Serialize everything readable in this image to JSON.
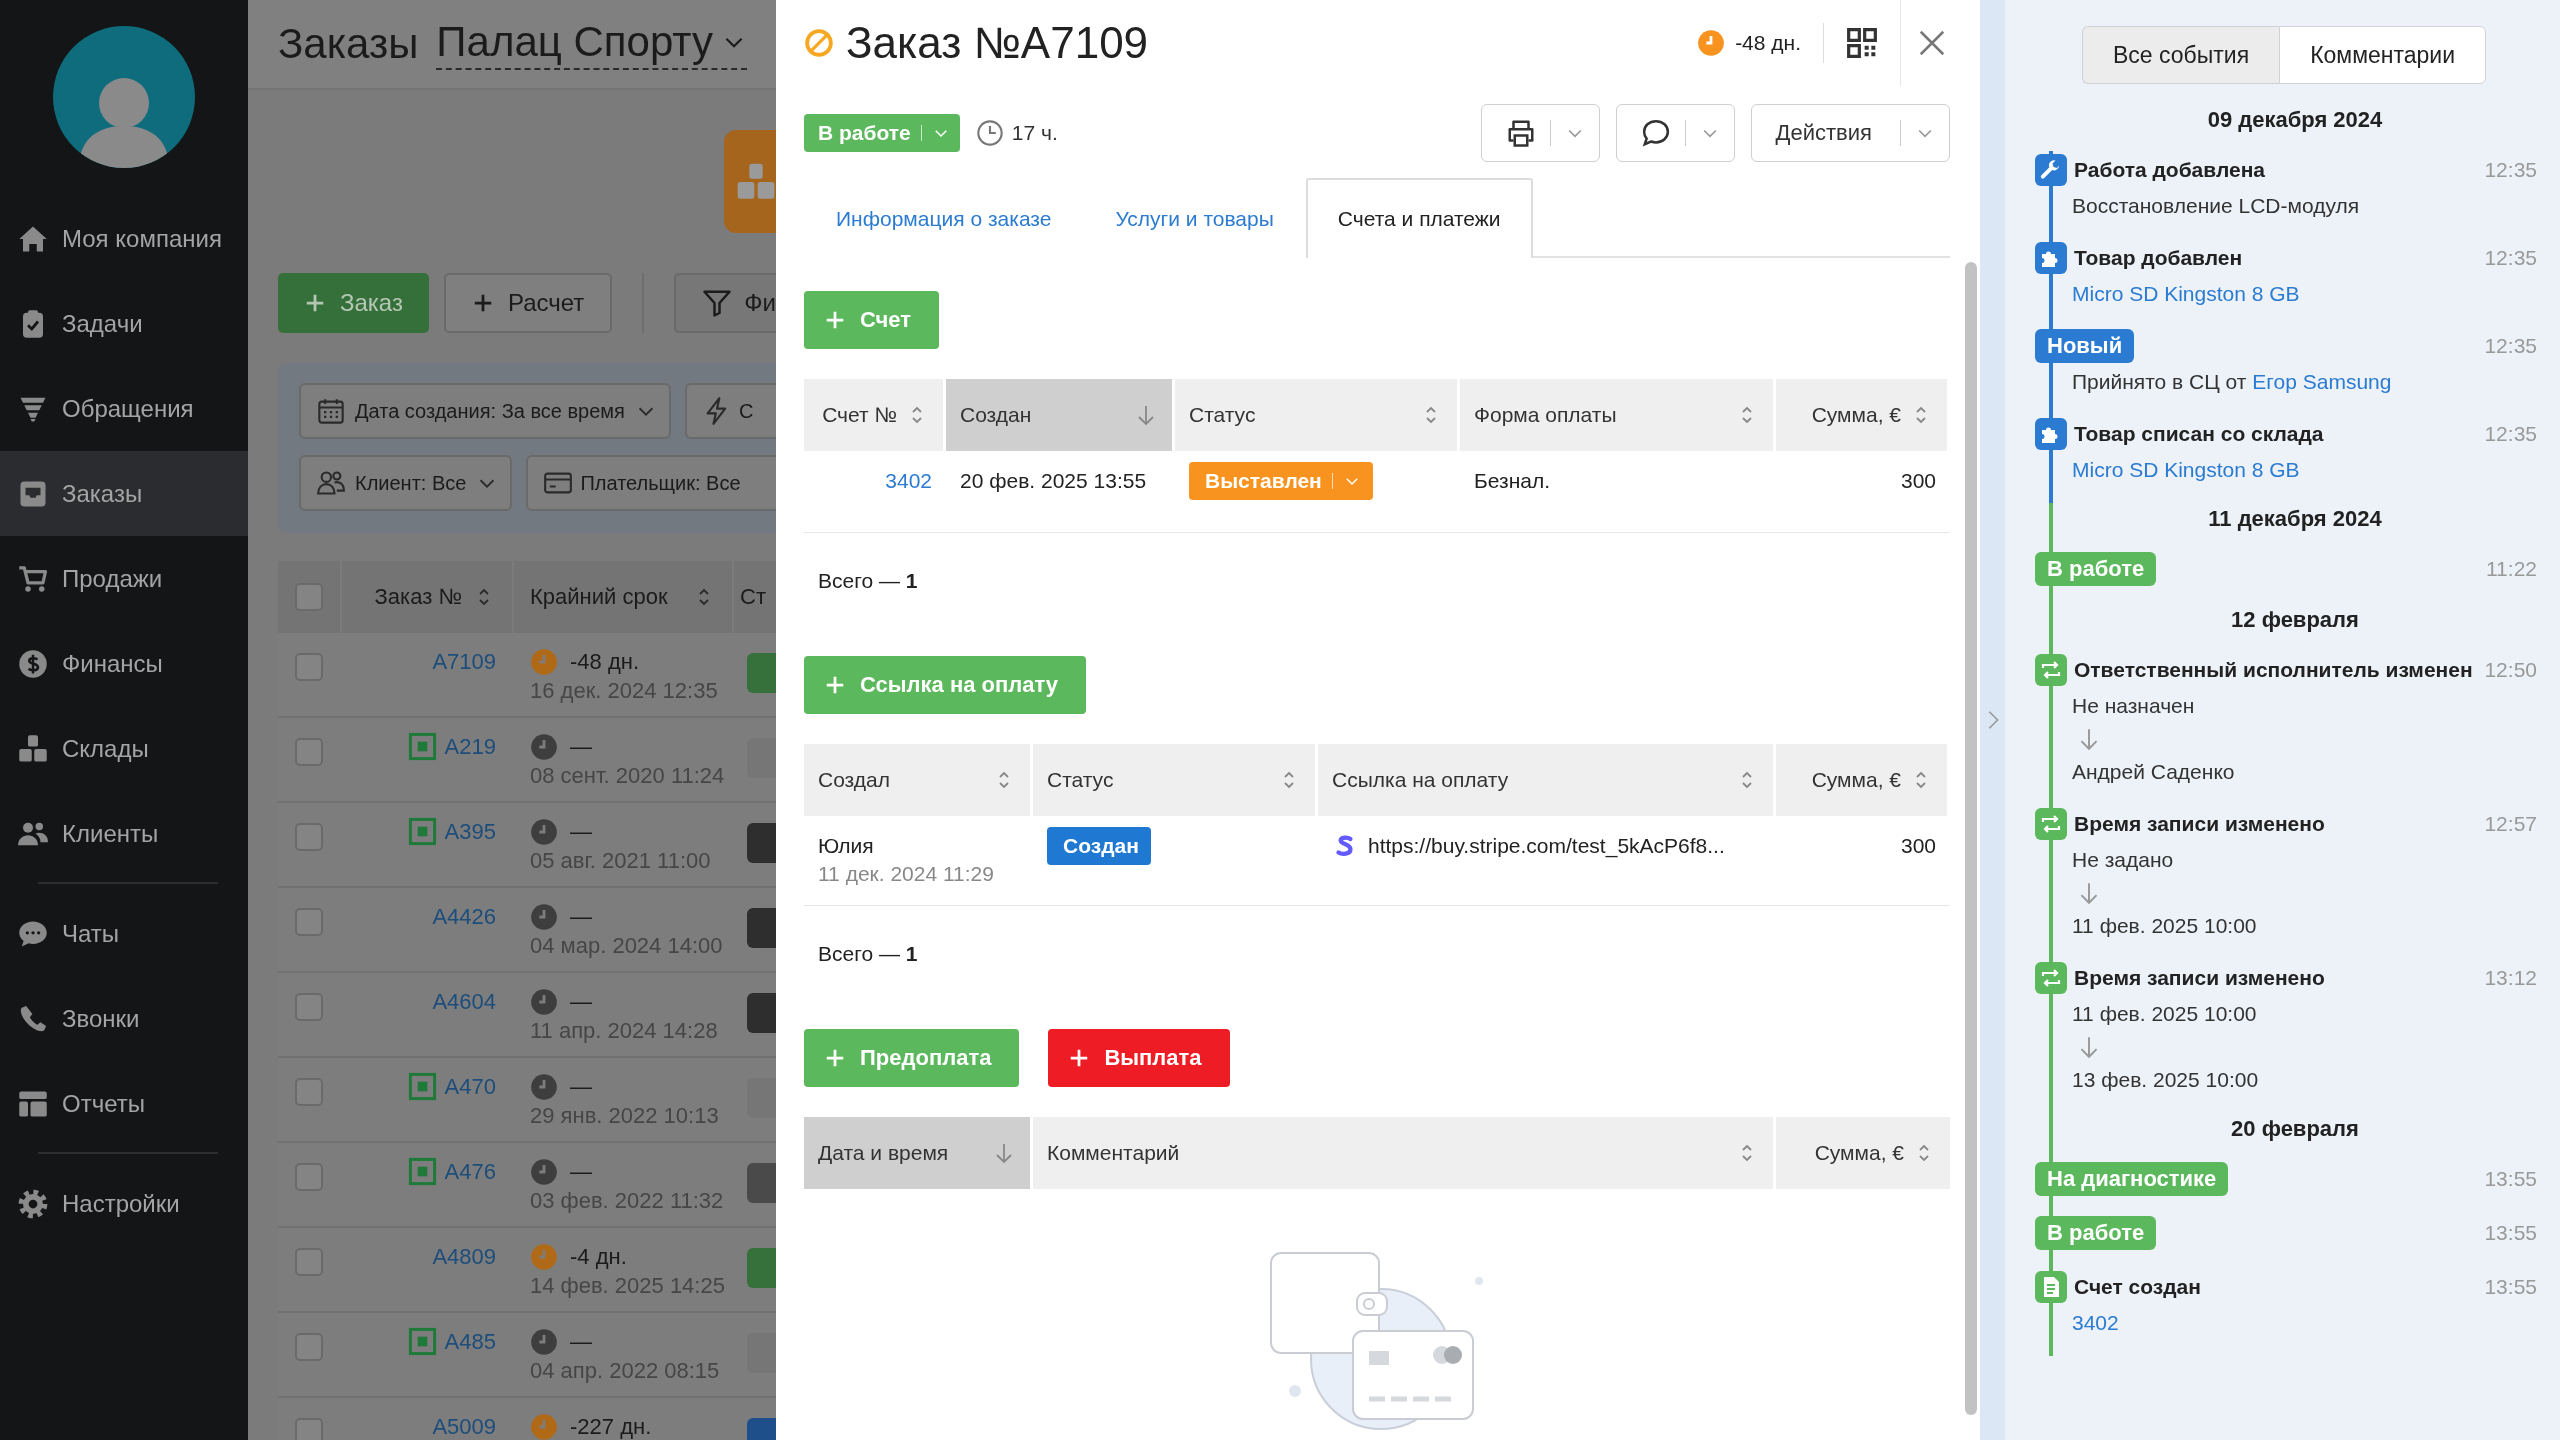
{
  "sidebar": {
    "sections": [
      {
        "items": [
          {
            "label": "Моя компания",
            "selected": false
          },
          {
            "label": "Задачи",
            "selected": false
          },
          {
            "label": "Обращения",
            "selected": false
          },
          {
            "label": "Заказы",
            "selected": true
          },
          {
            "label": "Продажи",
            "selected": false
          },
          {
            "label": "Финансы",
            "selected": false
          },
          {
            "label": "Склады",
            "selected": false
          },
          {
            "label": "Клиенты",
            "selected": false
          }
        ]
      },
      {
        "items": [
          {
            "label": "Чаты",
            "selected": false
          },
          {
            "label": "Звонки",
            "selected": false
          },
          {
            "label": "Отчеты",
            "selected": false
          }
        ]
      },
      {
        "items": [
          {
            "label": "Настройки",
            "selected": false
          }
        ]
      }
    ]
  },
  "orders_page": {
    "title": "Заказы",
    "location": "Палац Спорту",
    "buttons": [
      {
        "kind": "primary",
        "label": "Заказ"
      },
      {
        "kind": "secondary",
        "label": "Расчет"
      }
    ],
    "filter_button": "Фи",
    "filter_rows": [
      {
        "filters": [
          {
            "label": "Дата создания: За все время",
            "dropdown": true
          },
          {
            "label": "С",
            "dropdown": false
          }
        ]
      },
      {
        "filters": [
          {
            "label": "Клиент: Все",
            "dropdown": true
          },
          {
            "label": "Плательщик: Все",
            "dropdown": false
          }
        ]
      }
    ],
    "table": {
      "select_all": {
        "checked": false
      },
      "columns": [
        {
          "label": "Заказ №",
          "sortable": true
        },
        {
          "label": "Крайний срок",
          "sortable": true
        },
        {
          "label": "Ст",
          "sortable": false
        }
      ],
      "rows": [
        {
          "checked": false,
          "number": "A7109",
          "marked": false,
          "overdue": true,
          "deadline": "-48 дн.",
          "date": "16 дек. 2024 12:35",
          "color": "#36703a"
        },
        {
          "checked": false,
          "number": "A219",
          "marked": true,
          "overdue": false,
          "deadline": "—",
          "date": "08 сент. 2020 11:24",
          "color": "#767676"
        },
        {
          "checked": false,
          "number": "A395",
          "marked": true,
          "overdue": false,
          "deadline": "—",
          "date": "05 авг. 2021 11:00",
          "color": "#2e2e2e"
        },
        {
          "checked": false,
          "number": "A4426",
          "marked": false,
          "overdue": false,
          "deadline": "—",
          "date": "04 мар. 2024 14:00",
          "color": "#2e2e2e"
        },
        {
          "checked": false,
          "number": "A4604",
          "marked": false,
          "overdue": false,
          "deadline": "—",
          "date": "11 апр. 2024 14:28",
          "color": "#2e2e2e"
        },
        {
          "checked": false,
          "number": "A470",
          "marked": true,
          "overdue": false,
          "deadline": "—",
          "date": "29 янв. 2022 10:13",
          "color": "#767676"
        },
        {
          "checked": false,
          "number": "A476",
          "marked": true,
          "overdue": false,
          "deadline": "—",
          "date": "03 фев. 2022 11:32",
          "color": "#4a4a4a"
        },
        {
          "checked": false,
          "number": "A4809",
          "marked": false,
          "overdue": true,
          "deadline": "-4 дн.",
          "date": "14 фев. 2025 14:25",
          "color": "#36703a"
        },
        {
          "checked": false,
          "number": "A485",
          "marked": true,
          "overdue": false,
          "deadline": "—",
          "date": "04 апр. 2022 08:15",
          "color": "#767676"
        },
        {
          "checked": false,
          "number": "A5009",
          "marked": false,
          "overdue": true,
          "deadline": "-227 дн.",
          "color": "#1e4f8a"
        }
      ]
    }
  },
  "order": {
    "title": "Заказ №A7109",
    "deadline": {
      "text": "-48 дн.",
      "overdue": true
    },
    "status": {
      "label": "В работе",
      "color": "#5cb85c"
    },
    "status_time": "17 ч.",
    "actions_button": "Действия",
    "tabs": [
      {
        "label": "Информация о заказе",
        "selected": false
      },
      {
        "label": "Услуги и товары",
        "selected": false
      },
      {
        "label": "Счета и платежи",
        "selected": true
      }
    ],
    "invoices": {
      "add_button": "Счет",
      "columns": [
        {
          "label": "Счет №",
          "sorted": false,
          "numeric": true
        },
        {
          "label": "Создан",
          "sorted": true,
          "numeric": false
        },
        {
          "label": "Статус",
          "sorted": false,
          "numeric": false
        },
        {
          "label": "Форма оплаты",
          "sorted": false,
          "numeric": false
        },
        {
          "label": "Сумма, €",
          "sorted": false,
          "numeric": true
        }
      ],
      "rows": [
        {
          "number": "3402",
          "created": "20 фев. 2025 13:55",
          "status": {
            "label": "Выставлен",
            "color": "#f7931e",
            "dropdown": true
          },
          "payment_form": "Безнал.",
          "amount": "300"
        }
      ],
      "total": "Всего — **1**"
    },
    "payment_links": {
      "add_button": "Ссылка на оплату",
      "columns": [
        {
          "label": "Создал",
          "sorted": false,
          "numeric": false
        },
        {
          "label": "Статус",
          "sorted": false,
          "numeric": false
        },
        {
          "label": "Ссылка на оплату",
          "sorted": false,
          "numeric": false
        },
        {
          "label": "Сумма, €",
          "sorted": false,
          "numeric": true
        }
      ],
      "rows": [
        {
          "author": "Юлия",
          "created": "11 дек. 2024 11:29",
          "status": {
            "label": "Создан",
            "color": "#1f78d1",
            "dropdown": false
          },
          "url": "https://buy.stripe.com/test_5kAcP6f8...",
          "amount": "300"
        }
      ],
      "total": "Всего — **1**"
    },
    "payments": {
      "buttons": [
        {
          "kind": "prepayment",
          "label": "Предоплата"
        },
        {
          "kind": "payout",
          "label": "Выплата"
        }
      ],
      "columns": [
        {
          "label": "Дата и время",
          "sorted": true,
          "numeric": false
        },
        {
          "label": "Комментарий",
          "sorted": false,
          "numeric": false
        },
        {
          "label": "Сумма, €",
          "sorted": false,
          "numeric": true
        }
      ]
    }
  },
  "history": {
    "tabs": [
      {
        "label": "Все события",
        "selected": true
      },
      {
        "label": "Комментарии",
        "selected": false
      }
    ],
    "groups": [
      {
        "date": "09 декабря 2024",
        "events": [
          {
            "kind": "work",
            "color": "#2a7bd1",
            "title": "Работа добавлена",
            "time": "12:35",
            "body": [
              {
                "kind": "text",
                "text": "Восстановление LCD-модуля"
              }
            ]
          },
          {
            "kind": "product",
            "color": "#2a7bd1",
            "title": "Товар добавлен",
            "time": "12:35",
            "body": [
              {
                "kind": "link",
                "text": "Micro SD Kingston 8 GB"
              }
            ]
          },
          {
            "kind": "status",
            "color": "#2a7bd1",
            "title": "Новый",
            "time": "12:35",
            "body": [
              {
                "kind": "text_link",
                "text": "Прийнято в СЦ от",
                "link": "Егор Samsung"
              }
            ]
          },
          {
            "kind": "product",
            "color": "#2a7bd1",
            "title": "Товар списан со склада",
            "time": "12:35",
            "body": [
              {
                "kind": "link",
                "text": "Micro SD Kingston 8 GB"
              }
            ]
          }
        ]
      },
      {
        "date": "11 декабря 2024",
        "events": [
          {
            "kind": "status",
            "color": "#5cb85c",
            "title": "В работе",
            "time": "11:22"
          }
        ]
      },
      {
        "date": "12 февраля",
        "events": [
          {
            "kind": "change",
            "color": "#5cb85c",
            "title": "Ответственный исполнитель изменен",
            "time": "12:50",
            "body": [
              {
                "kind": "change",
                "from": "Не назначен",
                "to": "Андрей Саденко"
              }
            ]
          },
          {
            "kind": "change",
            "color": "#5cb85c",
            "title": "Время записи изменено",
            "time": "12:57",
            "body": [
              {
                "kind": "change",
                "from": "Не задано",
                "to": "11 фев. 2025 10:00"
              }
            ]
          },
          {
            "kind": "change",
            "color": "#5cb85c",
            "title": "Время записи изменено",
            "time": "13:12",
            "body": [
              {
                "kind": "change",
                "from": "11 фев. 2025 10:00",
                "to": "13 фев. 2025 10:00"
              }
            ]
          }
        ]
      },
      {
        "date": "20 февраля",
        "events": [
          {
            "kind": "status",
            "color": "#5cb85c",
            "title": "На диагностике",
            "time": "13:55"
          },
          {
            "kind": "status",
            "color": "#5cb85c",
            "title": "В работе",
            "time": "13:55"
          },
          {
            "kind": "invoice",
            "color": "#5cb85c",
            "title": "Счет создан",
            "time": "13:55",
            "body": [
              {
                "kind": "link",
                "text": "3402"
              }
            ]
          }
        ]
      }
    ]
  }
}
